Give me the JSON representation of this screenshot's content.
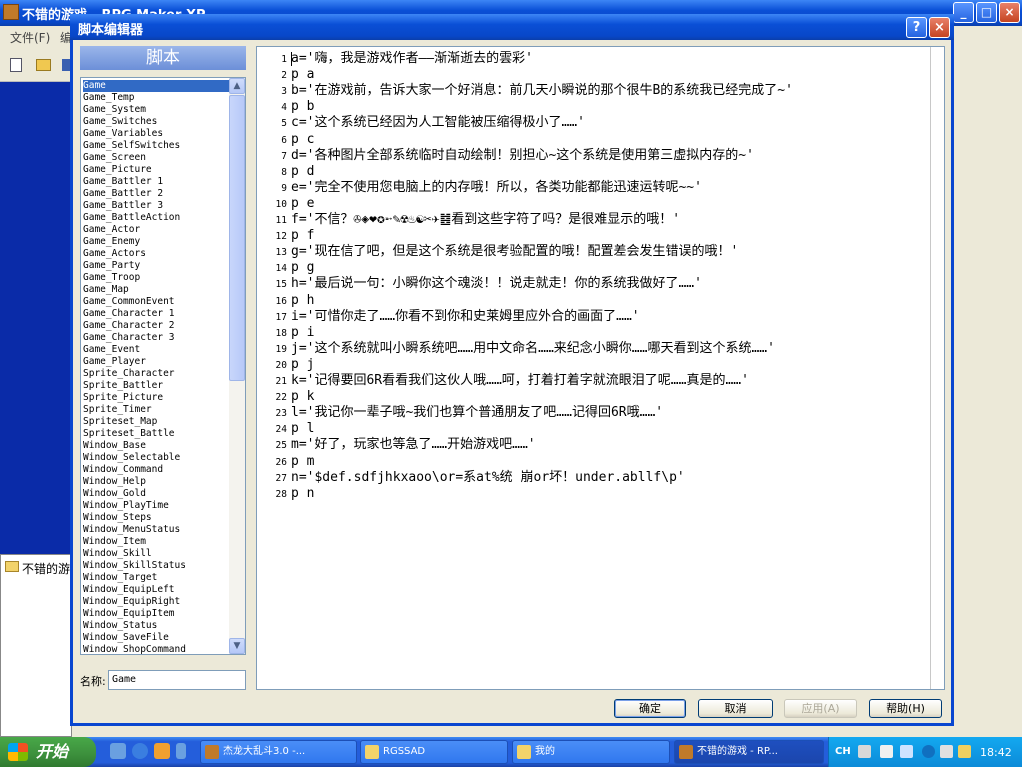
{
  "main_window": {
    "title": "不错的游戏 - RPG Maker XP",
    "menu": [
      "文件(F)",
      "编"
    ],
    "tree_item": "不错的游"
  },
  "dialog": {
    "title": "脚本编辑器",
    "help_icon": "?",
    "close_icon": "×",
    "list_header": "脚本",
    "script_list": [
      "Game",
      "Game_Temp",
      "Game_System",
      "Game_Switches",
      "Game_Variables",
      "Game_SelfSwitches",
      "Game_Screen",
      "Game_Picture",
      "Game_Battler 1",
      "Game_Battler 2",
      "Game_Battler 3",
      "Game_BattleAction",
      "Game_Actor",
      "Game_Enemy",
      "Game_Actors",
      "Game_Party",
      "Game_Troop",
      "Game_Map",
      "Game_CommonEvent",
      "Game_Character 1",
      "Game_Character 2",
      "Game_Character 3",
      "Game_Event",
      "Game_Player",
      "Sprite_Character",
      "Sprite_Battler",
      "Sprite_Picture",
      "Sprite_Timer",
      "Spriteset_Map",
      "Spriteset_Battle",
      "Window_Base",
      "Window_Selectable",
      "Window_Command",
      "Window_Help",
      "Window_Gold",
      "Window_PlayTime",
      "Window_Steps",
      "Window_MenuStatus",
      "Window_Item",
      "Window_Skill",
      "Window_SkillStatus",
      "Window_Target",
      "Window_EquipLeft",
      "Window_EquipRight",
      "Window_EquipItem",
      "Window_Status",
      "Window_SaveFile",
      "Window_ShopCommand"
    ],
    "selected_index": 0,
    "name_label": "名称:",
    "name_value": "Game",
    "code_lines": [
      "a='嗨，我是游戏作者——渐渐逝去的雲彩'",
      "p a",
      "b='在游戏前，告诉大家一个好消息：前几天小瞬说的那个很牛B的系统我已经完成了~'",
      "p b",
      "c='这个系统已经因为人工智能被压缩得极小了……'",
      "p c",
      "d='各种图片全部系统临时自动绘制！别担心~这个系统是使用第三虚拟内存的~'",
      "p d",
      "e='完全不使用您电脑上的内存哦！所以，各类功能都能迅速运转呢~~'",
      "p e",
      "f='不信？✇◈❤✪➵✎☢♨☯✂✈䷾看到这些字符了吗？是很难显示的哦！'",
      "p f",
      "g='现在信了吧，但是这个系统是很考验配置的哦！配置差会发生错误的哦！'",
      "p g",
      "h='最后说一句：小瞬你这个魂淡！！说走就走！你的系统我做好了……'",
      "p h",
      "i='可惜你走了……你看不到你和史莱姆里应外合的画面了……'",
      "p i",
      "j='这个系统就叫小瞬系统吧……用中文命名……来纪念小瞬你……哪天看到这个系统……'",
      "p j",
      "k='记得要回6R看看我们这伙人哦……呵，打着打着字就流眼泪了呢……真是的……'",
      "p k",
      "l='我记你一辈子哦~我们也算个普通朋友了吧……记得回6R哦……'",
      "p l",
      "m='好了，玩家也等急了……开始游戏吧……'",
      "p m",
      "n='$def.sdfjhkxaoo\\or=系at%统 崩or坏！under.abllf\\p'",
      "p n"
    ],
    "buttons": {
      "ok": "确定",
      "cancel": "取消",
      "apply": "应用(A)",
      "help": "帮助(H)"
    }
  },
  "taskbar": {
    "start": "开始",
    "tasks": [
      "杰龙大乱斗3.0 -...",
      "RGSSAD",
      "我的",
      "不错的游戏 - RP..."
    ],
    "lang": "CH",
    "clock": "18:42"
  }
}
